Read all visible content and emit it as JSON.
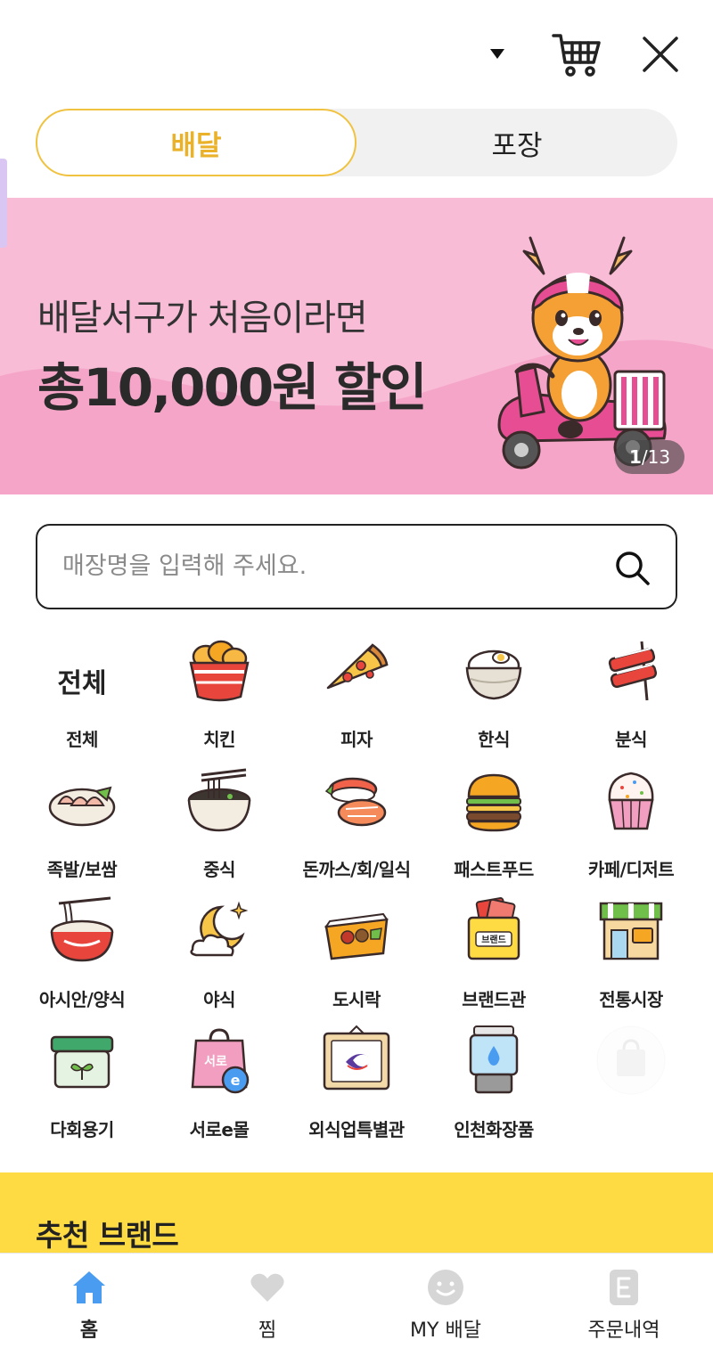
{
  "header": {
    "location_dropdown_icon": "caret-down-icon",
    "cart_icon": "cart-icon",
    "close_icon": "close-icon"
  },
  "mode_toggle": {
    "delivery_label": "배달",
    "pickup_label": "포장",
    "active": "배달",
    "active_color": "#e9b22a"
  },
  "banner": {
    "line1": "배달서구가 처음이라면",
    "line2": "총10,000원 할인",
    "counter_current": "1",
    "counter_total": "/13",
    "background_color": "#f8bcd7"
  },
  "search": {
    "placeholder": "매장명을 입력해 주세요.",
    "value": "",
    "icon": "search-icon"
  },
  "categories": {
    "all_icon_text": "전체",
    "items": [
      {
        "label": "전체",
        "icon": "all-text-icon"
      },
      {
        "label": "치킨",
        "icon": "chicken-icon"
      },
      {
        "label": "피자",
        "icon": "pizza-icon"
      },
      {
        "label": "한식",
        "icon": "rice-bowl-icon"
      },
      {
        "label": "분식",
        "icon": "skewer-icon"
      },
      {
        "label": "족발/보쌈",
        "icon": "pork-platter-icon"
      },
      {
        "label": "중식",
        "icon": "noodle-bowl-icon"
      },
      {
        "label": "돈까스/회/일식",
        "icon": "sushi-icon"
      },
      {
        "label": "패스트푸드",
        "icon": "burger-icon"
      },
      {
        "label": "카페/디저트",
        "icon": "cupcake-icon"
      },
      {
        "label": "아시안/양식",
        "icon": "pasta-bowl-icon"
      },
      {
        "label": "야식",
        "icon": "moon-icon"
      },
      {
        "label": "도시락",
        "icon": "lunchbox-icon"
      },
      {
        "label": "브랜드관",
        "icon": "brand-bag-icon"
      },
      {
        "label": "전통시장",
        "icon": "market-stall-icon"
      },
      {
        "label": "다회용기",
        "icon": "reusable-container-icon"
      },
      {
        "label": "서로e몰",
        "icon": "shopping-bag-icon"
      },
      {
        "label": "외식업특별관",
        "icon": "framed-logo-icon"
      },
      {
        "label": "인천화장품",
        "icon": "cosmetics-bottle-icon"
      }
    ],
    "bag_text": "서로",
    "brand_box_text": "브랜드"
  },
  "recommend": {
    "title": "추천 브랜드",
    "background_color": "#fedb43"
  },
  "bottom_nav": {
    "items": [
      {
        "label": "홈",
        "icon": "home-icon",
        "active": true
      },
      {
        "label": "찜",
        "icon": "heart-icon",
        "active": false
      },
      {
        "label": "MY 배달",
        "icon": "smiley-icon",
        "active": false
      },
      {
        "label": "주문내역",
        "icon": "receipt-icon",
        "active": false
      }
    ],
    "active_color": "#4a9cf0"
  }
}
